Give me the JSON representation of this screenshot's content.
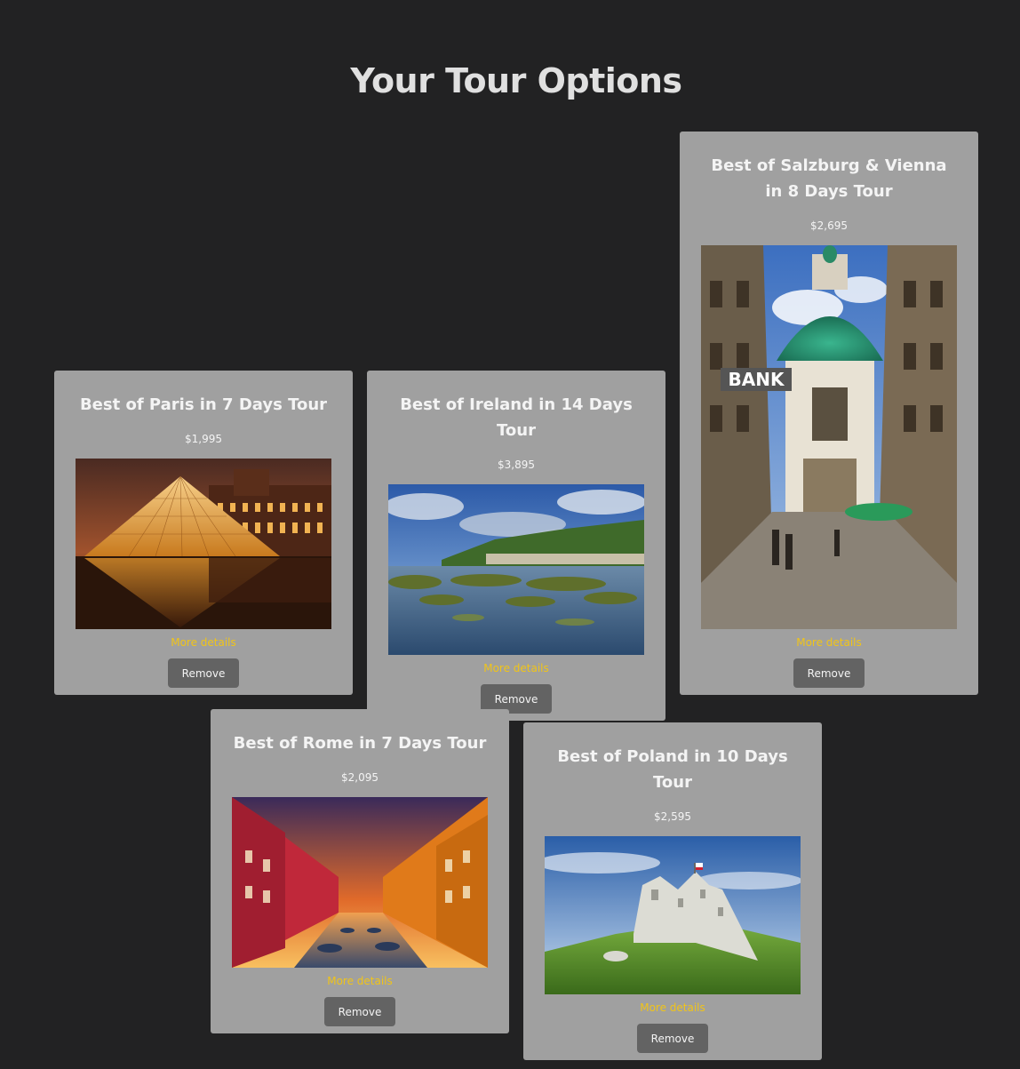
{
  "page": {
    "title": "Your Tour Options"
  },
  "tours": [
    {
      "title": "Best of Paris in 7 Days Tour",
      "price": "$1,995",
      "image_subject": "louvre-pyramid-night",
      "more_label": "More details",
      "remove_label": "Remove"
    },
    {
      "title": "Best of Ireland in 14 Days Tour",
      "price": "$3,895",
      "image_subject": "irish-coast-landscape",
      "more_label": "More details",
      "remove_label": "Remove"
    },
    {
      "title": "Best of Salzburg & Vienna in 8 Days Tour",
      "price": "$2,695",
      "image_subject": "vienna-street-green-dome-church",
      "more_label": "More details",
      "remove_label": "Remove"
    },
    {
      "title": "Best of Rome in 7 Days Tour",
      "price": "$2,095",
      "image_subject": "colorful-canal-houses-sunset",
      "more_label": "More details",
      "remove_label": "Remove"
    },
    {
      "title": "Best of Poland in 10 Days Tour",
      "price": "$2,595",
      "image_subject": "castle-ruins-on-hill",
      "more_label": "More details",
      "remove_label": "Remove"
    }
  ],
  "colors": {
    "background": "#222223",
    "card": "#a0a0a0",
    "link": "#f0c419",
    "button": "#636363",
    "text": "#f4f4f4"
  }
}
